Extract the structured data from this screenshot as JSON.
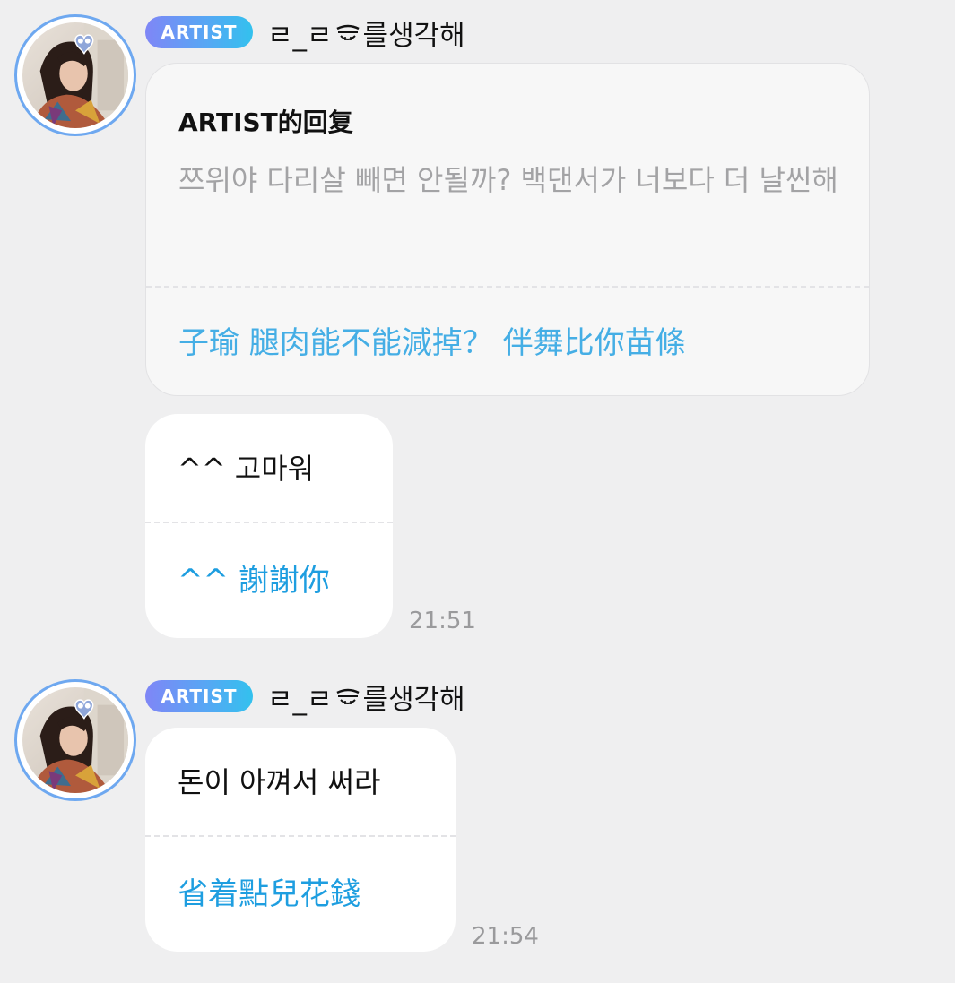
{
  "messages": [
    {
      "badge": "ARTIST",
      "username_pre": "ㄹ_ㄹ",
      "username_post": "를생각해",
      "reply": {
        "title": "ARTIST的回复",
        "text": "쯔위야 다리살 빼면 안될까? 백댄서가 너보다 더 날씬해",
        "translation": "子瑜 腿肉能不能減掉？ 伴舞比你苗條"
      },
      "bubble": {
        "text": "^^ 고마워",
        "translation": "^^ 謝謝你"
      },
      "time": "21:51"
    },
    {
      "badge": "ARTIST",
      "username_pre": "ㄹ_ㄹ",
      "username_post": "를생각해",
      "bubble": {
        "text": "돈이 아껴서 써라",
        "translation": "省着點兒花錢"
      },
      "time": "21:54"
    }
  ],
  "colors": {
    "background": "#efeff0",
    "badge_start": "#7f86f6",
    "badge_end": "#33c1ee",
    "translation": "#1e9ee0",
    "avatar_ring": "#6ea8f0",
    "muted_text": "#a3a3a5"
  },
  "icons": {
    "username_glyph": "smile-face-icon"
  }
}
